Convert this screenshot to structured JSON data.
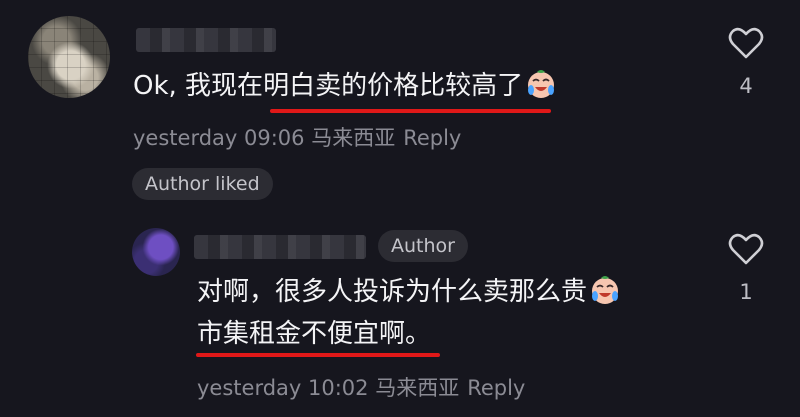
{
  "comments": [
    {
      "text_pre": "Ok, 我现在",
      "text_highlight": "明白卖的价格比较高了",
      "time": "yesterday 09:06 马来西亚",
      "reply_label": "Reply",
      "like_count": "4",
      "author_liked": "Author liked"
    },
    {
      "author_badge": "Author",
      "line1": "对啊，很多人投诉为什么卖那么贵",
      "line2": "市集租金不便宜啊。",
      "time": "yesterday 10:02 马来西亚",
      "reply_label": "Reply",
      "like_count": "1"
    }
  ],
  "icons": {
    "like": "heart-outline-icon",
    "emoji": "crying-laughing-emoji-icon"
  },
  "colors": {
    "background": "#16161e",
    "underline": "#e01818",
    "muted_text": "#8b8b94"
  }
}
